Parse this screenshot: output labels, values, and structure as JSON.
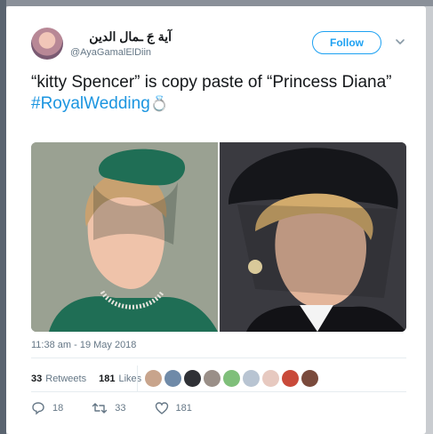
{
  "tweet": {
    "display_name": "آية جَ ـمال الدين",
    "handle": "@AyaGamalElDiin",
    "follow_label": "Follow",
    "text_line": "“kitty Spencer” is copy paste of “Princess Diana”",
    "hashtag": "#RoyalWedding",
    "emoji": "💍",
    "timestamp": "11:38 am - 19 May 2018"
  },
  "stats": {
    "retweets_count": "33",
    "retweets_label": "Retweets",
    "likes_count": "181",
    "likes_label": "Likes"
  },
  "likers": [
    "#c8a48c",
    "#6f8aa8",
    "#2f3136",
    "#9a8f88",
    "#7fbf7a",
    "#b8c4d2",
    "#e7c9c0",
    "#c94a3a",
    "#7a4a3c"
  ],
  "actions": {
    "reply_count": "18",
    "retweet_count": "33",
    "like_count": "181"
  },
  "colors": {
    "accent": "#1da1f2",
    "hashtag": "#1b95e0",
    "muted": "#657786"
  }
}
